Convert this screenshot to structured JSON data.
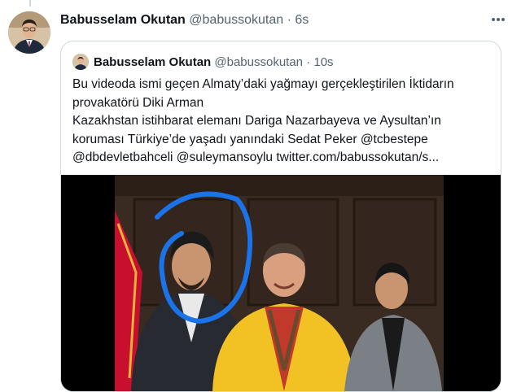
{
  "tweet": {
    "author_name": "Babusselam Okutan",
    "handle": "@babussokutan",
    "separator": "·",
    "time": "6s",
    "more_icon": "more-horizontal-icon"
  },
  "quoted": {
    "author_name": "Babusselam Okutan",
    "handle": "@babussokutan",
    "separator": "·",
    "time": "10s",
    "lines": [
      "Bu videoda ismi geçen Almaty’daki yağmayı gerçekleştirilen İktidarın",
      "provakatörü Diki Arman",
      "Kazakhstan istihbarat elemanı Dariga Nazarbayeva ve Aysultan’ın",
      "koruması Türkiye’de yaşadı yanındaki Sedat Peker @tcbestepe",
      "@dbdevletbahceli @suleymansoylu  twitter.com/babussokutan/s..."
    ]
  },
  "colors": {
    "text": "#0f1419",
    "secondary": "#536471",
    "border": "#cfd9de",
    "annotation_circle": "#1a73e8",
    "robe": "#f2c224",
    "flag": "#c8102e"
  }
}
